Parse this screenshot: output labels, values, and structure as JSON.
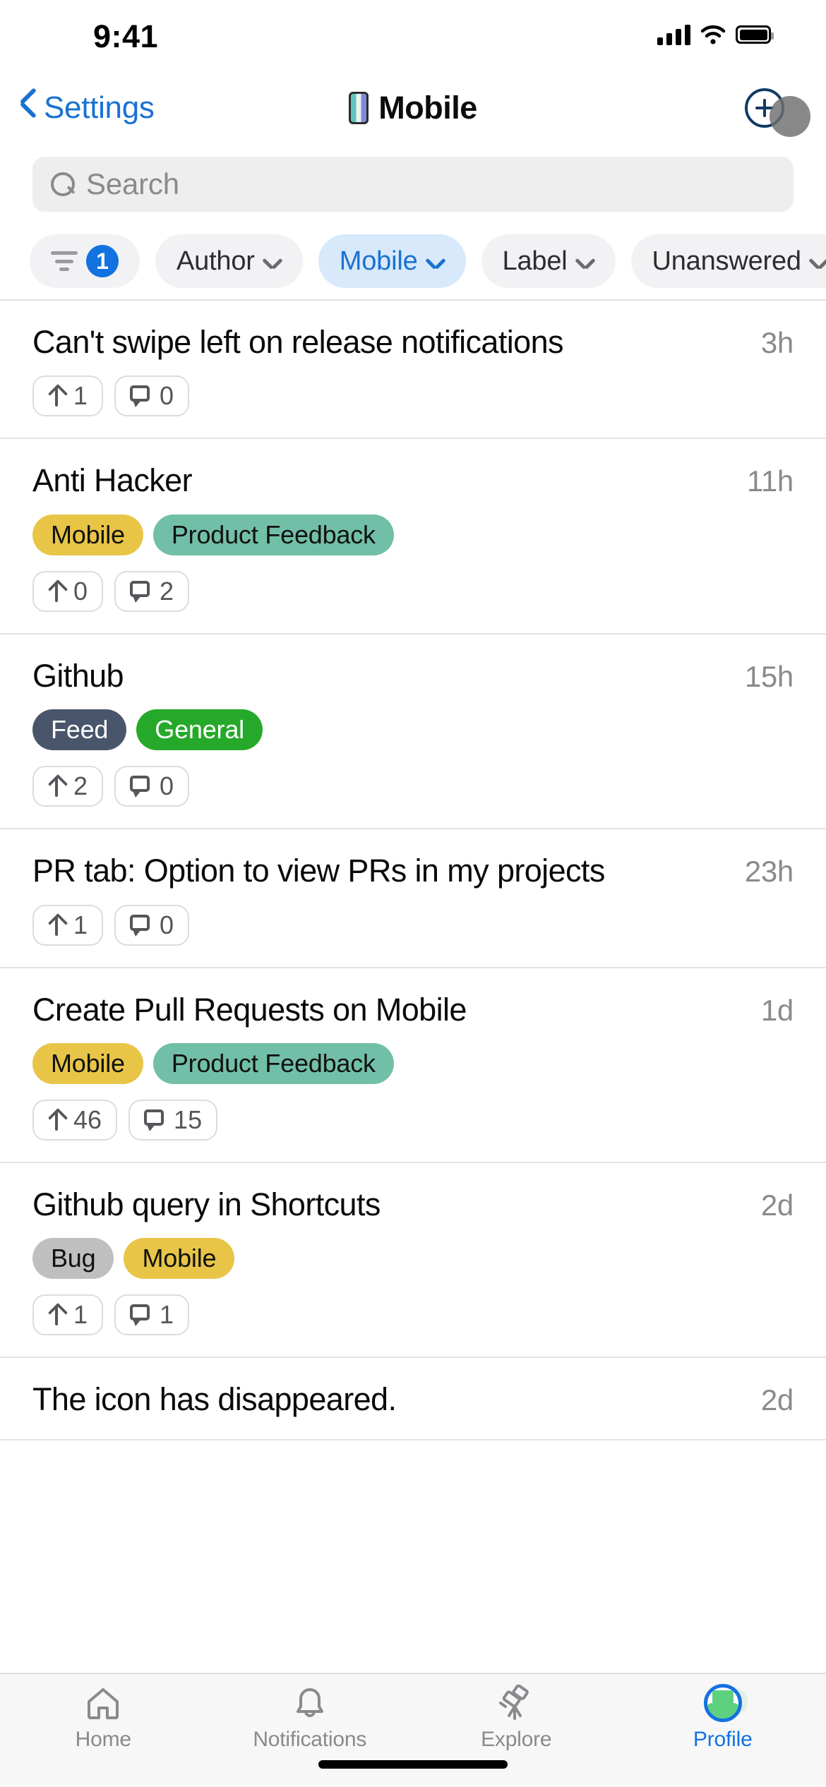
{
  "status_bar": {
    "time": "9:41",
    "signal_icon": "cellular-signal-icon",
    "wifi_icon": "wifi-icon",
    "battery_icon": "battery-icon"
  },
  "nav": {
    "back_label": "Settings",
    "back_icon": "chevron-left-icon",
    "title": "Mobile",
    "title_icon": "mobile-phone-icon",
    "add_icon": "plus-circle-icon",
    "accent": "#1a72d0",
    "add_color": "#123a66"
  },
  "search": {
    "placeholder": "Search",
    "icon": "search-icon",
    "value": ""
  },
  "filters": {
    "filter_icon": "filter-sliders-icon",
    "filter_count": "1",
    "badge_color": "#1272e0",
    "chips": [
      {
        "label": "Author",
        "active": false,
        "icon": "chevron-down-icon"
      },
      {
        "label": "Mobile",
        "active": true,
        "icon": "chevron-down-icon"
      },
      {
        "label": "Label",
        "active": false,
        "icon": "chevron-down-icon"
      },
      {
        "label": "Unanswered",
        "active": false,
        "icon": "chevron-down-icon"
      }
    ]
  },
  "tag_colors": {
    "Mobile": {
      "bg": "#e8c547",
      "fg": "#111111"
    },
    "Product Feedback": {
      "bg": "#72bfa8",
      "fg": "#111111"
    },
    "Feed": {
      "bg": "#49556b",
      "fg": "#ffffff"
    },
    "General": {
      "bg": "#26a92a",
      "fg": "#ffffff"
    },
    "Bug": {
      "bg": "#bfbfbf",
      "fg": "#111111"
    }
  },
  "posts": [
    {
      "title": "Can't swipe left on release notifications",
      "time": "3h",
      "tags": [],
      "upvotes": "1",
      "comments": "0"
    },
    {
      "title": "Anti Hacker",
      "time": "11h",
      "tags": [
        "Mobile",
        "Product Feedback"
      ],
      "upvotes": "0",
      "comments": "2"
    },
    {
      "title": "Github",
      "time": "15h",
      "tags": [
        "Feed",
        "General"
      ],
      "upvotes": "2",
      "comments": "0"
    },
    {
      "title": "PR tab: Option to view PRs in my projects",
      "time": "23h",
      "tags": [],
      "upvotes": "1",
      "comments": "0"
    },
    {
      "title": "Create Pull Requests on Mobile",
      "time": "1d",
      "tags": [
        "Mobile",
        "Product Feedback"
      ],
      "upvotes": "46",
      "comments": "15"
    },
    {
      "title": "Github query in Shortcuts",
      "time": "2d",
      "tags": [
        "Bug",
        "Mobile"
      ],
      "upvotes": "1",
      "comments": "1"
    },
    {
      "title": "The icon has disappeared.",
      "time": "2d",
      "tags": [],
      "upvotes": "",
      "comments": ""
    }
  ],
  "tabbar": {
    "items": [
      {
        "label": "Home",
        "icon": "home-icon",
        "active": false
      },
      {
        "label": "Notifications",
        "icon": "bell-icon",
        "active": false
      },
      {
        "label": "Explore",
        "icon": "telescope-icon",
        "active": false
      },
      {
        "label": "Profile",
        "icon": "avatar-icon",
        "active": true
      }
    ],
    "active_color": "#1272e0",
    "inactive_color": "#8a8a8e"
  }
}
